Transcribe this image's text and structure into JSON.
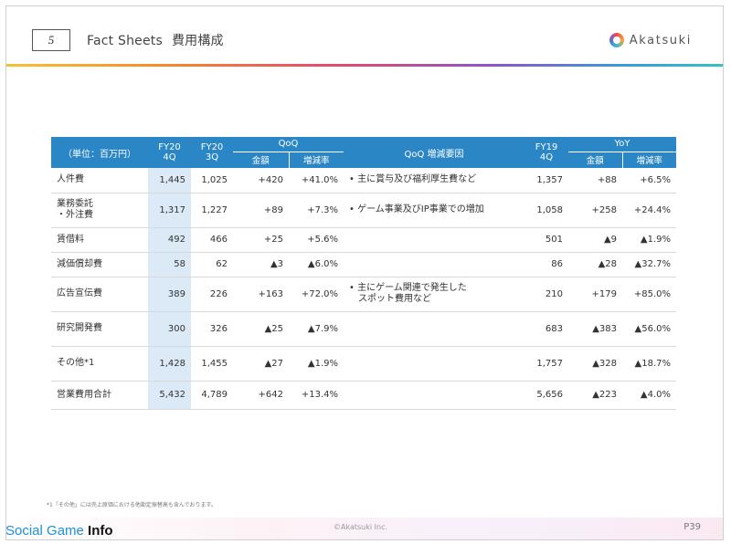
{
  "header": {
    "page_number": "5",
    "title": "Fact Sheets",
    "title_jp": "費用構成",
    "brand": "Akatsuki"
  },
  "table": {
    "col_headers": {
      "unit": "（単位：百万円）",
      "fy20_4q_a": "FY20",
      "fy20_4q_b": "4Q",
      "fy20_3q_a": "FY20",
      "fy20_3q_b": "3Q",
      "qoq": "QoQ",
      "qoq_amount": "金額",
      "qoq_rate": "増減率",
      "qoq_reason": "QoQ 増減要因",
      "fy19_4q_a": "FY19",
      "fy19_4q_b": "4Q",
      "yoy": "YoY",
      "yoy_amount": "金額",
      "yoy_rate": "増減率"
    },
    "rows": [
      {
        "name1": "人件費",
        "name2": "",
        "fy20_4q": "1,445",
        "fy20_3q": "1,025",
        "qoq_amt": "+420",
        "qoq_rate": "+41.0%",
        "reason1": "• 主に賞与及び福利厚生費など",
        "reason2": "",
        "fy19_4q": "1,357",
        "yoy_amt": "+88",
        "yoy_rate": "+6.5%"
      },
      {
        "name1": "業務委託",
        "name2": "・外注費",
        "fy20_4q": "1,317",
        "fy20_3q": "1,227",
        "qoq_amt": "+89",
        "qoq_rate": "+7.3%",
        "reason1": "• ゲーム事業及びIP事業での増加",
        "reason2": "",
        "fy19_4q": "1,058",
        "yoy_amt": "+258",
        "yoy_rate": "+24.4%"
      },
      {
        "name1": "賃借料",
        "name2": "",
        "fy20_4q": "492",
        "fy20_3q": "466",
        "qoq_amt": "+25",
        "qoq_rate": "+5.6%",
        "reason1": "",
        "reason2": "",
        "fy19_4q": "501",
        "yoy_amt": "▲9",
        "yoy_rate": "▲1.9%"
      },
      {
        "name1": "減価償却費",
        "name2": "",
        "fy20_4q": "58",
        "fy20_3q": "62",
        "qoq_amt": "▲3",
        "qoq_rate": "▲6.0%",
        "reason1": "",
        "reason2": "",
        "fy19_4q": "86",
        "yoy_amt": "▲28",
        "yoy_rate": "▲32.7%"
      },
      {
        "name1": "広告宣伝費",
        "name2": "",
        "fy20_4q": "389",
        "fy20_3q": "226",
        "qoq_amt": "+163",
        "qoq_rate": "+72.0%",
        "reason1": "• 主にゲーム関連で発生した",
        "reason2": "スポット費用など",
        "fy19_4q": "210",
        "yoy_amt": "+179",
        "yoy_rate": "+85.0%"
      },
      {
        "name1": "研究開発費",
        "name2": "",
        "fy20_4q": "300",
        "fy20_3q": "326",
        "qoq_amt": "▲25",
        "qoq_rate": "▲7.9%",
        "reason1": "",
        "reason2": "",
        "fy19_4q": "683",
        "yoy_amt": "▲383",
        "yoy_rate": "▲56.0%"
      },
      {
        "name1": "その他*1",
        "name2": "",
        "fy20_4q": "1,428",
        "fy20_3q": "1,455",
        "qoq_amt": "▲27",
        "qoq_rate": "▲1.9%",
        "reason1": "",
        "reason2": "",
        "fy19_4q": "1,757",
        "yoy_amt": "▲328",
        "yoy_rate": "▲18.7%"
      },
      {
        "name1": "営業費用合計",
        "name2": "",
        "fy20_4q": "5,432",
        "fy20_3q": "4,789",
        "qoq_amt": "+642",
        "qoq_rate": "+13.4%",
        "reason1": "",
        "reason2": "",
        "fy19_4q": "5,656",
        "yoy_amt": "▲223",
        "yoy_rate": "▲4.0%"
      }
    ]
  },
  "footer": {
    "footnote": "*1「その他」には売上原価における他勘定振替高も含んでおります。",
    "copyright": "©Akatsuki Inc.",
    "page": "P39",
    "watermark_a": "Social Game",
    "watermark_b": "Info"
  },
  "colors": {
    "header_blue": "#2b86c5",
    "highlight_column": "#dce9f6"
  }
}
